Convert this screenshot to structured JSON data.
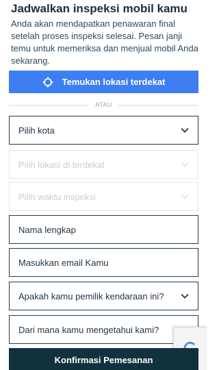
{
  "header": {
    "title": "Jadwalkan inspeksi mobil kamu",
    "description": "Anda akan mendapatkan penawaran final setelah proses inspeksi selesai. Pesan janji temu untuk memeriksa dan menjual mobil Anda sekarang."
  },
  "locate_button": {
    "label": "Temukan lokasi terdekat",
    "icon": "crosshair-icon"
  },
  "divider": {
    "text": "ATAU"
  },
  "form": {
    "city_select": {
      "value": "Pilih kota"
    },
    "location_select": {
      "value": "Pilih lokasi di terdekat"
    },
    "time_select": {
      "value": "Pilih waktu inspeksi"
    },
    "name_input": {
      "placeholder": "Nama lengkap"
    },
    "email_input": {
      "placeholder": "Masukkan email Kamu"
    },
    "owner_select": {
      "value": "Apakah kamu pemilik kendaraan ini?"
    },
    "source_select": {
      "value": "Dari mana kamu mengetahui kami?"
    }
  },
  "confirm_button": {
    "label": "Konfirmasi Pemesanan"
  },
  "colors": {
    "primary_blue": "#3d7ef2",
    "dark_teal": "#10323e",
    "field_border": "#1f3b4b",
    "disabled_text": "#c7ced4"
  }
}
